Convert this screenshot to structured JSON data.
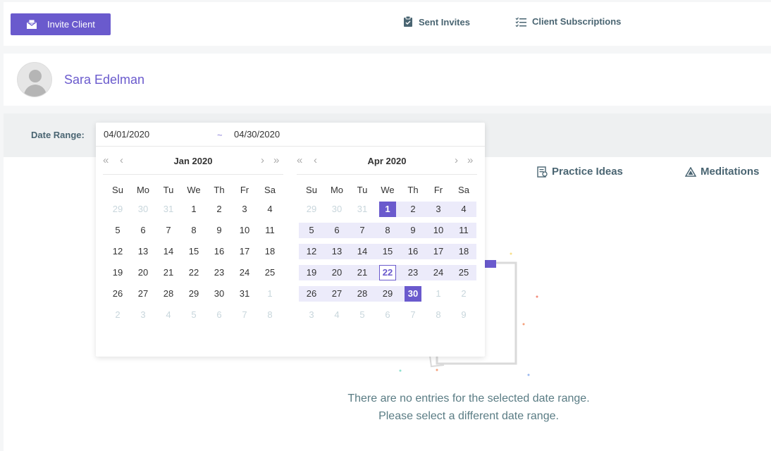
{
  "topbar": {
    "invite_label": "Invite Client",
    "sent_invites_label": "Sent Invites",
    "subscriptions_label": "Client Subscriptions"
  },
  "profile": {
    "name": "Sara Edelman"
  },
  "filter": {
    "range_label": "Date Range:",
    "start_date": "04/01/2020",
    "end_date": "04/30/2020",
    "separator": "~"
  },
  "tabs": {
    "practice_ideas": "Practice Ideas",
    "meditations": "Meditations"
  },
  "empty": {
    "line1": "There are no entries for the selected date range.",
    "line2": "Please select a different date range."
  },
  "colors": {
    "accent": "#6a5acd",
    "range_bg": "#ecebfa",
    "muted_text": "#c8d6dc",
    "body_text": "#5a7c84"
  },
  "calendars": [
    {
      "title": "Jan 2020",
      "dows": [
        "Su",
        "Mo",
        "Tu",
        "We",
        "Th",
        "Fr",
        "Sa"
      ],
      "weeks": [
        [
          [
            "29",
            "muted"
          ],
          [
            "30",
            "muted"
          ],
          [
            "31",
            "muted"
          ],
          [
            "1",
            ""
          ],
          [
            "2",
            ""
          ],
          [
            "3",
            ""
          ],
          [
            "4",
            ""
          ]
        ],
        [
          [
            "5",
            ""
          ],
          [
            "6",
            ""
          ],
          [
            "7",
            ""
          ],
          [
            "8",
            ""
          ],
          [
            "9",
            ""
          ],
          [
            "10",
            ""
          ],
          [
            "11",
            ""
          ]
        ],
        [
          [
            "12",
            ""
          ],
          [
            "13",
            ""
          ],
          [
            "14",
            ""
          ],
          [
            "15",
            ""
          ],
          [
            "16",
            ""
          ],
          [
            "17",
            ""
          ],
          [
            "18",
            ""
          ]
        ],
        [
          [
            "19",
            ""
          ],
          [
            "20",
            ""
          ],
          [
            "21",
            ""
          ],
          [
            "22",
            ""
          ],
          [
            "23",
            ""
          ],
          [
            "24",
            ""
          ],
          [
            "25",
            ""
          ]
        ],
        [
          [
            "26",
            ""
          ],
          [
            "27",
            ""
          ],
          [
            "28",
            ""
          ],
          [
            "29",
            ""
          ],
          [
            "30",
            ""
          ],
          [
            "31",
            ""
          ],
          [
            "1",
            "muted"
          ]
        ],
        [
          [
            "2",
            "muted"
          ],
          [
            "3",
            "muted"
          ],
          [
            "4",
            "muted"
          ],
          [
            "5",
            "muted"
          ],
          [
            "6",
            "muted"
          ],
          [
            "7",
            "muted"
          ],
          [
            "8",
            "muted"
          ]
        ]
      ]
    },
    {
      "title": "Apr 2020",
      "dows": [
        "Su",
        "Mo",
        "Tu",
        "We",
        "Th",
        "Fr",
        "Sa"
      ],
      "weeks": [
        [
          [
            "29",
            "muted"
          ],
          [
            "30",
            "muted"
          ],
          [
            "31",
            "muted"
          ],
          [
            "1",
            "start"
          ],
          [
            "2",
            "inrange"
          ],
          [
            "3",
            "inrange"
          ],
          [
            "4",
            "inrange"
          ]
        ],
        [
          [
            "5",
            "inrange"
          ],
          [
            "6",
            "inrange"
          ],
          [
            "7",
            "inrange"
          ],
          [
            "8",
            "inrange"
          ],
          [
            "9",
            "inrange"
          ],
          [
            "10",
            "inrange"
          ],
          [
            "11",
            "inrange"
          ]
        ],
        [
          [
            "12",
            "inrange"
          ],
          [
            "13",
            "inrange"
          ],
          [
            "14",
            "inrange"
          ],
          [
            "15",
            "inrange"
          ],
          [
            "16",
            "inrange"
          ],
          [
            "17",
            "inrange"
          ],
          [
            "18",
            "inrange"
          ]
        ],
        [
          [
            "19",
            "inrange"
          ],
          [
            "20",
            "inrange"
          ],
          [
            "21",
            "inrange"
          ],
          [
            "22",
            "today"
          ],
          [
            "23",
            "inrange"
          ],
          [
            "24",
            "inrange"
          ],
          [
            "25",
            "inrange"
          ]
        ],
        [
          [
            "26",
            "inrange"
          ],
          [
            "27",
            "inrange"
          ],
          [
            "28",
            "inrange"
          ],
          [
            "29",
            "inrange"
          ],
          [
            "30",
            "end"
          ],
          [
            "1",
            "muted"
          ],
          [
            "2",
            "muted"
          ]
        ],
        [
          [
            "3",
            "muted"
          ],
          [
            "4",
            "muted"
          ],
          [
            "5",
            "muted"
          ],
          [
            "6",
            "muted"
          ],
          [
            "7",
            "muted"
          ],
          [
            "8",
            "muted"
          ],
          [
            "9",
            "muted"
          ]
        ]
      ]
    }
  ]
}
